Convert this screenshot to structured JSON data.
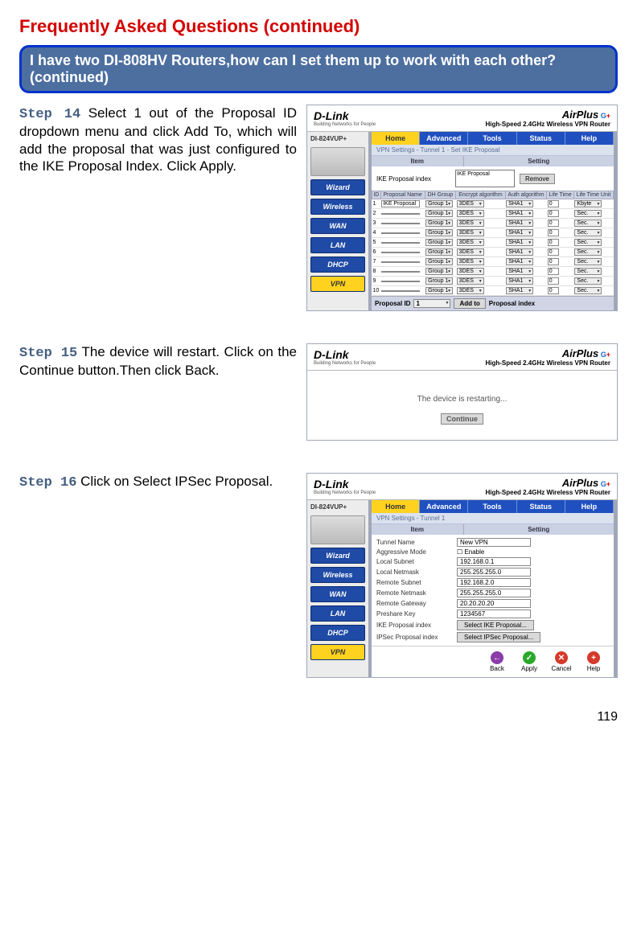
{
  "page": {
    "title": "Frequently Asked Questions (continued)",
    "question": "I have two DI-808HV Routers,how can I set them up to work with each other?  (continued)",
    "number": "119"
  },
  "steps": {
    "s14": {
      "label": "Step 14",
      "text": " Select 1 out of the Proposal ID dropdown menu and click Add To, which will add the proposal that was just configured to the IKE Proposal Index. Click Apply."
    },
    "s15": {
      "label": "Step 15",
      "text": " The device will restart. Click on the Continue button.Then click Back."
    },
    "s16": {
      "label": "Step 16",
      "text": " Click on Select IPSec Proposal."
    }
  },
  "shot_common": {
    "dlink": "D-Link",
    "dlink_sub": "Building Networks for People",
    "airplus": "AirPlus",
    "g": "G",
    "plus": "+",
    "router_type": "High-Speed 2.4GHz Wireless VPN Router",
    "model": "DI-824VUP+",
    "tabs": {
      "home": "Home",
      "advanced": "Advanced",
      "tools": "Tools",
      "status": "Status",
      "help": "Help"
    },
    "side": {
      "wizard": "Wizard",
      "wireless": "Wireless",
      "wan": "WAN",
      "lan": "LAN",
      "dhcp": "DHCP",
      "vpn": "VPN"
    }
  },
  "shot14": {
    "section": "VPN Settings - Tunnel 1 - Set IKE Proposal",
    "item": "Item",
    "setting": "Setting",
    "ike_index": "IKE Proposal index",
    "ike_val": "IKE Proposal",
    "remove": "Remove",
    "hdr": {
      "id": "ID",
      "pname": "Proposal Name",
      "dh": "DH Group",
      "enc": "Encrypt algorithm",
      "auth": "Auth algorithm",
      "life": "Life Time",
      "unit": "Life Time Unit"
    },
    "rows": [
      {
        "n": "1",
        "name": "IKE Proposal",
        "dh": "Group 1",
        "enc": "3DES",
        "auth": "SHA1",
        "life": "0",
        "unit": "Kbyte"
      },
      {
        "n": "2",
        "name": "",
        "dh": "Group 1",
        "enc": "3DES",
        "auth": "SHA1",
        "life": "0",
        "unit": "Sec."
      },
      {
        "n": "3",
        "name": "",
        "dh": "Group 1",
        "enc": "3DES",
        "auth": "SHA1",
        "life": "0",
        "unit": "Sec."
      },
      {
        "n": "4",
        "name": "",
        "dh": "Group 1",
        "enc": "3DES",
        "auth": "SHA1",
        "life": "0",
        "unit": "Sec."
      },
      {
        "n": "5",
        "name": "",
        "dh": "Group 1",
        "enc": "3DES",
        "auth": "SHA1",
        "life": "0",
        "unit": "Sec."
      },
      {
        "n": "6",
        "name": "",
        "dh": "Group 1",
        "enc": "3DES",
        "auth": "SHA1",
        "life": "0",
        "unit": "Sec."
      },
      {
        "n": "7",
        "name": "",
        "dh": "Group 1",
        "enc": "3DES",
        "auth": "SHA1",
        "life": "0",
        "unit": "Sec."
      },
      {
        "n": "8",
        "name": "",
        "dh": "Group 1",
        "enc": "3DES",
        "auth": "SHA1",
        "life": "0",
        "unit": "Sec."
      },
      {
        "n": "9",
        "name": "",
        "dh": "Group 1",
        "enc": "3DES",
        "auth": "SHA1",
        "life": "0",
        "unit": "Sec."
      },
      {
        "n": "10",
        "name": "",
        "dh": "Group 1",
        "enc": "3DES",
        "auth": "SHA1",
        "life": "0",
        "unit": "Sec."
      }
    ],
    "foot": {
      "pid": "Proposal ID",
      "pid_val": "1",
      "addto": "Add to",
      "pidx": "Proposal index"
    }
  },
  "shot15": {
    "msg": "The device is restarting...",
    "continue": "Continue"
  },
  "shot16": {
    "section": "VPN Settings - Tunnel 1",
    "item": "Item",
    "setting": "Setting",
    "rows": {
      "tunnel": "Tunnel Name",
      "tunnel_v": "New VPN",
      "aggr": "Aggressive Mode",
      "aggr_v": "Enable",
      "lsub": "Local Subnet",
      "lsub_v": "192.168.0.1",
      "lmask": "Local Netmask",
      "lmask_v": "255.255.255.0",
      "rsub": "Remote Subnet",
      "rsub_v": "192.168.2.0",
      "rmask": "Remote Netmask",
      "rmask_v": "255.255.255.0",
      "rgw": "Remote Gateway",
      "rgw_v": "20.20.20.20",
      "psk": "Preshare Key",
      "psk_v": "1234567",
      "ike": "IKE Proposal index",
      "ike_btn": "Select IKE Proposal...",
      "ipsec": "IPSec Proposal index",
      "ipsec_btn": "Select IPSec Proposal..."
    },
    "actions": {
      "back": "Back",
      "apply": "Apply",
      "cancel": "Cancel",
      "help": "Help"
    }
  }
}
